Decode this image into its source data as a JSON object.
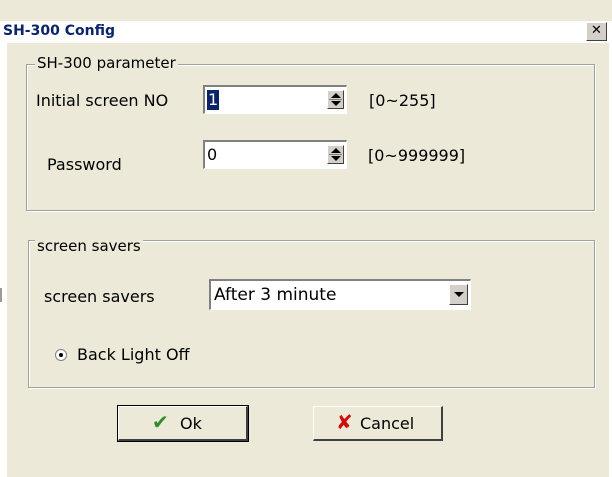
{
  "window": {
    "title": "SH-300 Config",
    "close_glyph": "✕"
  },
  "parameter_group": {
    "legend": "SH-300 parameter",
    "initial_screen": {
      "label": "Initial screen NO",
      "value": "1",
      "range": "[0~255]"
    },
    "password": {
      "label": "Password",
      "value": "0",
      "range": "[0~999999]"
    }
  },
  "screen_savers_group": {
    "legend": "screen savers",
    "label": "screen savers",
    "selected": "After 3 minute",
    "radio_label": "Back Light Off",
    "radio_checked": true
  },
  "buttons": {
    "ok_label": "Ok",
    "ok_icon": "checkmark-icon",
    "cancel_label": "Cancel",
    "cancel_icon": "x-mark-icon"
  },
  "colors": {
    "title_text": "#0a246a",
    "dialog_bg": "#ece9d8",
    "ok_check": "#2e8b2e",
    "cancel_x": "#cc1010"
  }
}
